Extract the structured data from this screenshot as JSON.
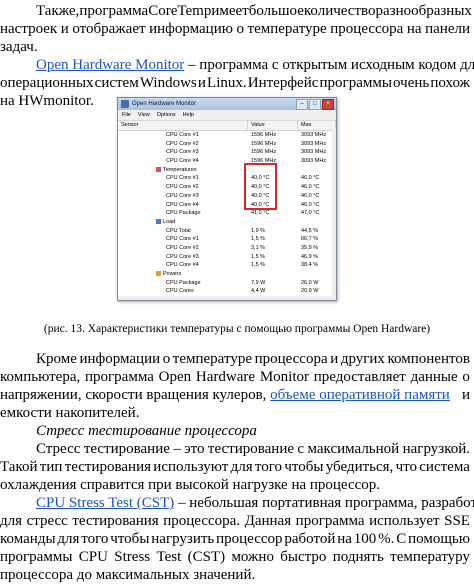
{
  "para1": {
    "l1": [
      "Также,",
      "программа",
      "Core",
      "Temp",
      "имеет",
      "большое",
      "количество",
      "разнообразных"
    ],
    "l2": [
      "настроек",
      "и",
      "отображает",
      "информацию",
      "о",
      "температуре",
      "процессора",
      "на",
      "панели"
    ],
    "l3": "задач."
  },
  "para2": {
    "link": "Open Hardware Monitor",
    "l1_rest": "– программа с открытым исходным кодом для",
    "l2": [
      "операционных",
      "систем",
      "Windows",
      "и",
      "Linux.",
      "Интерфейс",
      "программы",
      "очень",
      "похож"
    ],
    "l3": "на HWmonitor."
  },
  "ohm": {
    "title": "Open Hardware Monitor",
    "window_buttons": [
      "–",
      "□",
      "×"
    ],
    "menu": [
      "File",
      "View",
      "Options",
      "Help"
    ],
    "columns": [
      "Sensor",
      "Value",
      "Max"
    ],
    "rows": [
      {
        "name": "CPU Core #1",
        "value": "1596 MHz",
        "max": "3093 MHz"
      },
      {
        "name": "CPU Core #2",
        "value": "1596 MHz",
        "max": "3093 MHz"
      },
      {
        "name": "CPU Core #3",
        "value": "1596 MHz",
        "max": "3093 MHz"
      },
      {
        "name": "CPU Core #4",
        "value": "1596 MHz",
        "max": "3093 MHz"
      },
      {
        "name": "Temperatures",
        "value": "",
        "max": "",
        "group": true,
        "icon": "thermometer-icon"
      },
      {
        "name": "CPU Core #1",
        "value": "40,0 °C",
        "max": "46,0 °C"
      },
      {
        "name": "CPU Core #2",
        "value": "40,0 °C",
        "max": "46,0 °C"
      },
      {
        "name": "CPU Core #3",
        "value": "40,0 °C",
        "max": "46,0 °C"
      },
      {
        "name": "CPU Core #4",
        "value": "40,0 °C",
        "max": "46,0 °C"
      },
      {
        "name": "CPU Package",
        "value": "41,0 °C",
        "max": "47,0 °C"
      },
      {
        "name": "Load",
        "value": "",
        "max": "",
        "group": true,
        "icon": "load-icon"
      },
      {
        "name": "CPU Total",
        "value": "1,9 %",
        "max": "44,5 %"
      },
      {
        "name": "CPU Core #1",
        "value": "1,5 %",
        "max": "66,7 %"
      },
      {
        "name": "CPU Core #2",
        "value": "3,1 %",
        "max": "35,9 %"
      },
      {
        "name": "CPU Core #3",
        "value": "1,5 %",
        "max": "46,9 %"
      },
      {
        "name": "CPU Core #4",
        "value": "1,5 %",
        "max": "38,4 %"
      },
      {
        "name": "Powers",
        "value": "",
        "max": "",
        "group": true,
        "icon": "power-icon"
      },
      {
        "name": "CPU Package",
        "value": "7,9 W",
        "max": "26,0 W"
      },
      {
        "name": "CPU Cores",
        "value": "4,4 W",
        "max": "20,9 W"
      }
    ]
  },
  "caption": "(рис. 13.  Характеристики температуры с помощью программы Open Hardware)",
  "para3": {
    "l1": [
      "Кроме",
      "информации",
      "о",
      "температуре",
      "процессора",
      "и",
      "других",
      "компонентов"
    ],
    "l2": [
      "компьютера,",
      "программа",
      "Open",
      "Hardware",
      "Monitor",
      "предоставляет",
      "данные",
      "о"
    ],
    "l3_pre": "напряжении,  скорости  вращения  кулеров,",
    "l3_link": "объеме оперативной памяти",
    "l3_post": "и",
    "l4": "емкости накопителей."
  },
  "heading": "Стресс тестирование процессора",
  "para4": {
    "l1": [
      "Стресс",
      "тестирование",
      "–",
      "это",
      "тестирование",
      "с",
      "максимальной",
      "нагрузкой."
    ],
    "l2": [
      "Такой",
      "тип",
      "тестирования",
      "используют",
      "для",
      "того",
      "чтобы",
      "убедиться,",
      "что",
      "система"
    ],
    "l3": "охлаждения справится при высокой нагрузке на процессор."
  },
  "para5": {
    "link": "CPU Stress Test (CST)",
    "l1_rest": "– небольшая портативная программа, разработанная",
    "l2": [
      "для",
      "стресс",
      "тестирования",
      "процессора.",
      "Данная",
      "программа",
      "использует",
      "SSE"
    ],
    "l3": [
      "команды",
      "для",
      "того",
      "чтобы",
      "нагрузить",
      "процессор",
      "работой",
      "на",
      "100",
      "%.",
      "С",
      "помощью"
    ],
    "l4": [
      "программы",
      "CPU",
      "Stress",
      "Test",
      "(CST)",
      "можно",
      "быстро",
      "поднять",
      "температуру"
    ],
    "l5": "процессора до максимальных значений."
  }
}
